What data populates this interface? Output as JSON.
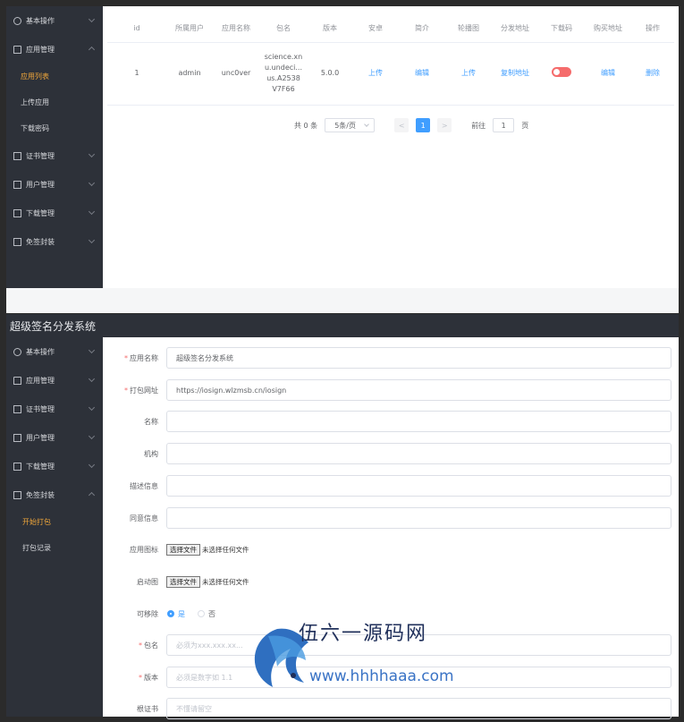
{
  "top": {
    "sidebar": {
      "menus": [
        {
          "label": "基本操作",
          "icon": "user-icon"
        },
        {
          "label": "应用管理",
          "icon": "home-icon"
        }
      ],
      "app_sub": [
        {
          "label": "应用列表",
          "active": true
        },
        {
          "label": "上传应用",
          "active": false
        },
        {
          "label": "下载密码",
          "active": false
        }
      ],
      "menus_after": [
        {
          "label": "证书管理"
        },
        {
          "label": "用户管理"
        },
        {
          "label": "下载管理"
        },
        {
          "label": "免签封装"
        }
      ]
    },
    "table": {
      "headers": [
        "id",
        "所属用户",
        "应用名称",
        "包名",
        "版本",
        "安卓",
        "简介",
        "轮播图",
        "分发地址",
        "下载码",
        "购买地址",
        "操作"
      ],
      "row": {
        "id": "1",
        "user": "admin",
        "app_name": "unc0ver",
        "package_lines": [
          "science.xn",
          "u.undeci...",
          "us.A2538",
          "V7F66"
        ],
        "version": "5.0.0",
        "android": "上传",
        "intro": "编辑",
        "carousel": "上传",
        "dist": "复制地址",
        "download_code_enabled": true,
        "buy": "编辑",
        "action": "删除"
      }
    },
    "pager": {
      "total": "共 0 条",
      "size": "5条/页",
      "prev": "<",
      "page": "1",
      "next": ">",
      "goto_label": "前往",
      "goto_value": "1",
      "goto_suffix": "页"
    }
  },
  "bottom": {
    "title": "超级签名分发系统",
    "sidebar": {
      "menus": [
        {
          "label": "基本操作",
          "icon": "user-icon"
        },
        {
          "label": "应用管理",
          "icon": "home-icon"
        },
        {
          "label": "证书管理",
          "icon": "doc-icon"
        },
        {
          "label": "用户管理",
          "icon": "doc-icon"
        },
        {
          "label": "下载管理",
          "icon": "doc-icon"
        },
        {
          "label": "免签封装",
          "icon": "doc-icon"
        }
      ],
      "sub": [
        {
          "label": "开始打包",
          "active": true
        },
        {
          "label": "打包记录",
          "active": false
        }
      ]
    },
    "form": {
      "app_name": {
        "label": "应用名称",
        "value": "超级签名分发系统"
      },
      "pack_url": {
        "label": "打包网址",
        "value": "https://iosign.wlzmsb.cn/iosign"
      },
      "name": {
        "label": "名称",
        "value": ""
      },
      "org": {
        "label": "机构",
        "value": ""
      },
      "desc": {
        "label": "描述信息",
        "value": ""
      },
      "consent": {
        "label": "同意信息",
        "value": ""
      },
      "app_icon": {
        "label": "应用图标",
        "button": "选择文件",
        "status": "未选择任何文件"
      },
      "splash": {
        "label": "启动图",
        "button": "选择文件",
        "status": "未选择任何文件"
      },
      "removable": {
        "label": "可移除",
        "yes": "是",
        "no": "否"
      },
      "package": {
        "label": "包名",
        "placeholder": "必须为xxx.xxx.xx..."
      },
      "version": {
        "label": "版本",
        "placeholder": "必须是数字如 1.1"
      },
      "cert": {
        "label": "根证书",
        "placeholder": "不懂请留空"
      }
    }
  },
  "watermark": {
    "title": "伍六一源码网",
    "url": "www.hhhhaaa.com"
  }
}
